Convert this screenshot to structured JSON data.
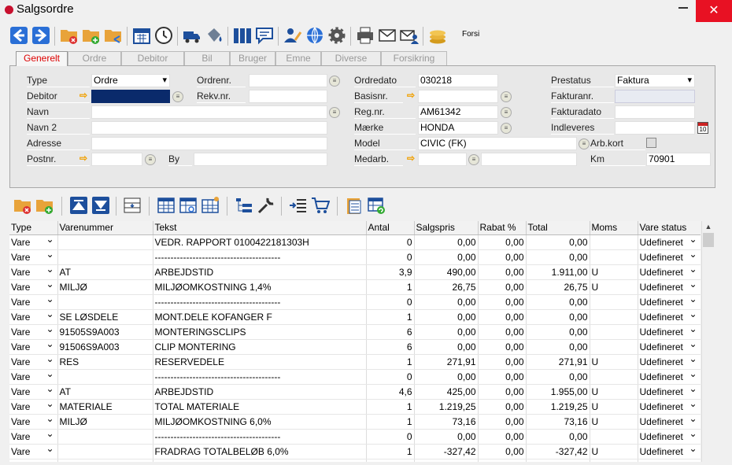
{
  "window": {
    "title": "Salgsordre",
    "close_glyph": "✕"
  },
  "toolbar": {
    "forsi_label": "Forsi"
  },
  "tabs": [
    "Generelt",
    "Ordre",
    "Debitor",
    "Bil",
    "Bruger",
    "Emne",
    "Diverse",
    "Forsikring"
  ],
  "form": {
    "type_label": "Type",
    "type_value": "Ordre",
    "debitor_label": "Debitor",
    "debitor_value": "",
    "navn_label": "Navn",
    "navn_value": "",
    "navn2_label": "Navn 2",
    "navn2_value": "",
    "adresse_label": "Adresse",
    "adresse_value": "",
    "postnr_label": "Postnr.",
    "postnr_value": "",
    "by_label": "By",
    "by_value": "",
    "ordrenr_label": "Ordrenr.",
    "ordrenr_value": "",
    "rekvnr_label": "Rekv.nr.",
    "rekvnr_value": "",
    "ordredato_label": "Ordredato",
    "ordredato_value": "030218",
    "basisnr_label": "Basisnr.",
    "basisnr_value": "",
    "regnr_label": "Reg.nr.",
    "regnr_value": "AM61342",
    "maerke_label": "Mærke",
    "maerke_value": "HONDA",
    "model_label": "Model",
    "model_value": "CIVIC (FK)",
    "medarb_label": "Medarb.",
    "medarb_value": "",
    "prestatus_label": "Prestatus",
    "prestatus_value": "Faktura",
    "fakturanr_label": "Fakturanr.",
    "fakturanr_value": "",
    "fakturadato_label": "Fakturadato",
    "fakturadato_value": "",
    "indleveres_label": "Indleveres",
    "indleveres_value": "",
    "arbkort_label": "Arb.kort",
    "km_label": "Km",
    "km_value": "70901",
    "calendar_day": "10"
  },
  "grid": {
    "headers": [
      "Type",
      "Varenummer",
      "Tekst",
      "Antal",
      "Salgspris",
      "Rabat %",
      "Total",
      "Moms",
      "Vare status"
    ],
    "rows": [
      [
        "Vare",
        "",
        "VEDR. RAPPORT 0100422181303H",
        "0",
        "0,00",
        "0,00",
        "0,00",
        "",
        "Udefineret"
      ],
      [
        "Vare",
        "",
        "----------------------------------------",
        "0",
        "0,00",
        "0,00",
        "0,00",
        "",
        "Udefineret"
      ],
      [
        "Vare",
        "AT",
        "ARBEJDSTID",
        "3,9",
        "490,00",
        "0,00",
        "1.911,00",
        "U",
        "Udefineret"
      ],
      [
        "Vare",
        "MILJØ",
        "MILJØOMKOSTNING  1,4%",
        "1",
        "26,75",
        "0,00",
        "26,75",
        "U",
        "Udefineret"
      ],
      [
        "Vare",
        "",
        "----------------------------------------",
        "0",
        "0,00",
        "0,00",
        "0,00",
        "",
        "Udefineret"
      ],
      [
        "Vare",
        "SE LØSDELE",
        "MONT.DELE KOFANGER F",
        "1",
        "0,00",
        "0,00",
        "0,00",
        "",
        "Udefineret"
      ],
      [
        "Vare",
        "91505S9A003",
        "MONTERINGSCLIPS",
        "6",
        "0,00",
        "0,00",
        "0,00",
        "",
        "Udefineret"
      ],
      [
        "Vare",
        "91506S9A003",
        "CLIP MONTERING",
        "6",
        "0,00",
        "0,00",
        "0,00",
        "",
        "Udefineret"
      ],
      [
        "Vare",
        "RES",
        "RESERVEDELE",
        "1",
        "271,91",
        "0,00",
        "271,91",
        "U",
        "Udefineret"
      ],
      [
        "Vare",
        "",
        "----------------------------------------",
        "0",
        "0,00",
        "0,00",
        "0,00",
        "",
        "Udefineret"
      ],
      [
        "Vare",
        "AT",
        "ARBEJDSTID",
        "4,6",
        "425,00",
        "0,00",
        "1.955,00",
        "U",
        "Udefineret"
      ],
      [
        "Vare",
        "MATERIALE",
        "TOTAL MATERIALE",
        "1",
        "1.219,25",
        "0,00",
        "1.219,25",
        "U",
        "Udefineret"
      ],
      [
        "Vare",
        "MILJØ",
        "MILJØOMKOSTNING  6,0%",
        "1",
        "73,16",
        "0,00",
        "73,16",
        "U",
        "Udefineret"
      ],
      [
        "Vare",
        "",
        "----------------------------------------",
        "0",
        "0,00",
        "0,00",
        "0,00",
        "",
        "Udefineret"
      ],
      [
        "Vare",
        "",
        "FRADRAG TOTALBELØB  6,0%",
        "1",
        "-327,42",
        "0,00",
        "-327,42",
        "U",
        "Udefineret"
      ],
      [
        "",
        "",
        "",
        "",
        "",
        "",
        "",
        "",
        ""
      ]
    ]
  }
}
